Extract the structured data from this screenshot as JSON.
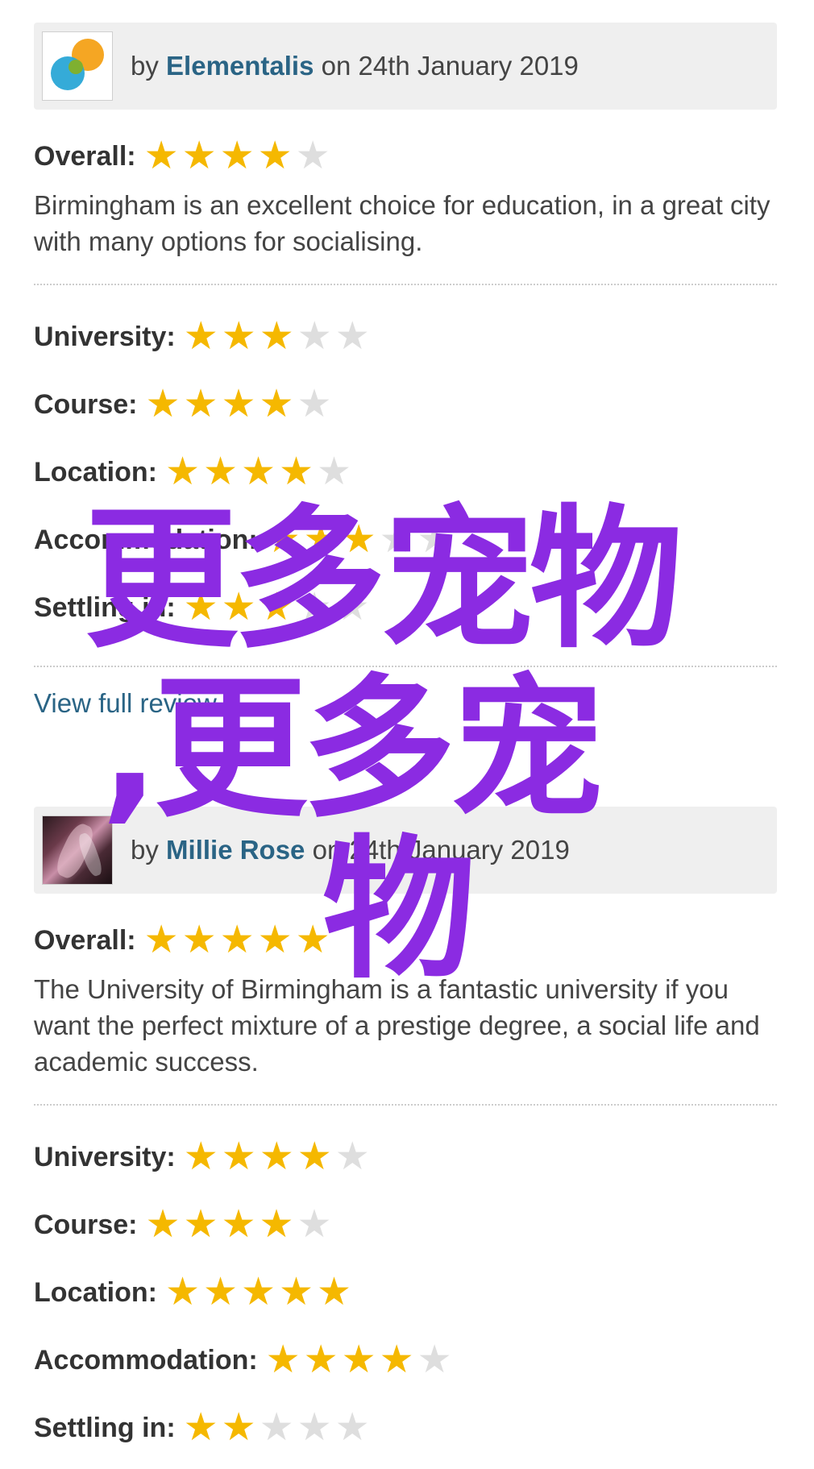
{
  "reviews": [
    {
      "by_prefix": "by",
      "author": "Elementalis",
      "date_text": "on 24th January 2019",
      "avatar": "orange-blue-logo-avatar",
      "overall_label": "Overall:",
      "overall_stars": 4,
      "summary": "Birmingham is an excellent choice for education, in a great city with many options for socialising.",
      "ratings": [
        {
          "label": "University:",
          "stars": 3
        },
        {
          "label": "Course:",
          "stars": 4
        },
        {
          "label": "Location:",
          "stars": 4
        },
        {
          "label": "Accommodation:",
          "stars": 3
        },
        {
          "label": "Settling in:",
          "stars": 3
        }
      ],
      "view_link": "View full review"
    },
    {
      "by_prefix": "by",
      "author": "Millie Rose",
      "date_text": "on 24th January 2019",
      "avatar": "photo-avatar",
      "overall_label": "Overall:",
      "overall_stars": 5,
      "summary": "The University of Birmingham is a fantastic university if you want the perfect mixture of a prestige degree, a social life and academic success.",
      "ratings": [
        {
          "label": "University:",
          "stars": 4
        },
        {
          "label": "Course:",
          "stars": 4
        },
        {
          "label": "Location:",
          "stars": 5
        },
        {
          "label": "Accommodation:",
          "stars": 4
        },
        {
          "label": "Settling in:",
          "stars": 2
        }
      ]
    }
  ],
  "max_stars": 5,
  "star_icons": {
    "filled": "star-filled-icon",
    "empty": "star-empty-icon"
  },
  "colors": {
    "star_on": "#f5b800",
    "star_off": "#dedede",
    "author_link": "#2a6485",
    "watermark": "#8b2be2"
  },
  "watermark": {
    "line1": "更多宠物",
    "line2": ",更多宠",
    "line3": "物"
  }
}
